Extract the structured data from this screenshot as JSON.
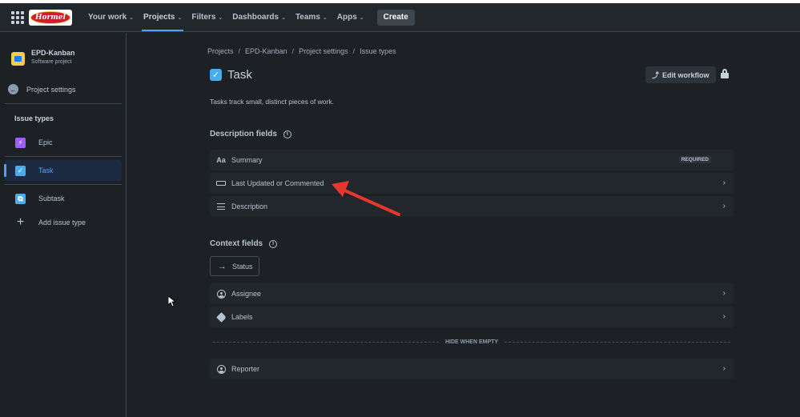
{
  "nav": {
    "logo_text": "Hormel",
    "items": [
      {
        "label": "Your work"
      },
      {
        "label": "Projects"
      },
      {
        "label": "Filters"
      },
      {
        "label": "Dashboards"
      },
      {
        "label": "Teams"
      },
      {
        "label": "Apps"
      }
    ],
    "active": "Projects",
    "create_label": "Create"
  },
  "sidebar": {
    "project_name": "EPD-Kanban",
    "project_type": "Software project",
    "back_label": "Project settings",
    "section_heading": "Issue types",
    "issue_types": [
      {
        "label": "Epic",
        "icon": "epic-icon",
        "color": "#9f5df5",
        "selected": false
      },
      {
        "label": "Task",
        "icon": "task-icon",
        "color": "#4bade8",
        "selected": true
      },
      {
        "label": "Subtask",
        "icon": "subtask-icon",
        "color": "#4bade8",
        "selected": false
      }
    ],
    "add_label": "Add issue type"
  },
  "breadcrumb": [
    "Projects",
    "EPD-Kanban",
    "Project settings",
    "Issue types"
  ],
  "page": {
    "title": "Task",
    "description": "Tasks track small, distinct pieces of work.",
    "edit_workflow_label": "Edit workflow"
  },
  "description_fields": {
    "heading": "Description fields",
    "items": [
      {
        "label": "Summary",
        "icon": "text-icon",
        "badge": "REQUIRED"
      },
      {
        "label": "Last Updated or Commented",
        "icon": "field-box-icon"
      },
      {
        "label": "Description",
        "icon": "lines-icon"
      }
    ]
  },
  "context_fields": {
    "heading": "Context fields",
    "status_label": "Status",
    "items": [
      {
        "label": "Assignee",
        "icon": "user-icon"
      },
      {
        "label": "Labels",
        "icon": "tag-icon"
      }
    ],
    "hide_when_empty": "HIDE WHEN EMPTY",
    "hidden_items": [
      {
        "label": "Reporter",
        "icon": "user-icon"
      }
    ]
  },
  "colors": {
    "background": "#1d2125",
    "surface": "#22272b",
    "accent": "#579dff",
    "annotation_arrow": "#e5372f"
  }
}
